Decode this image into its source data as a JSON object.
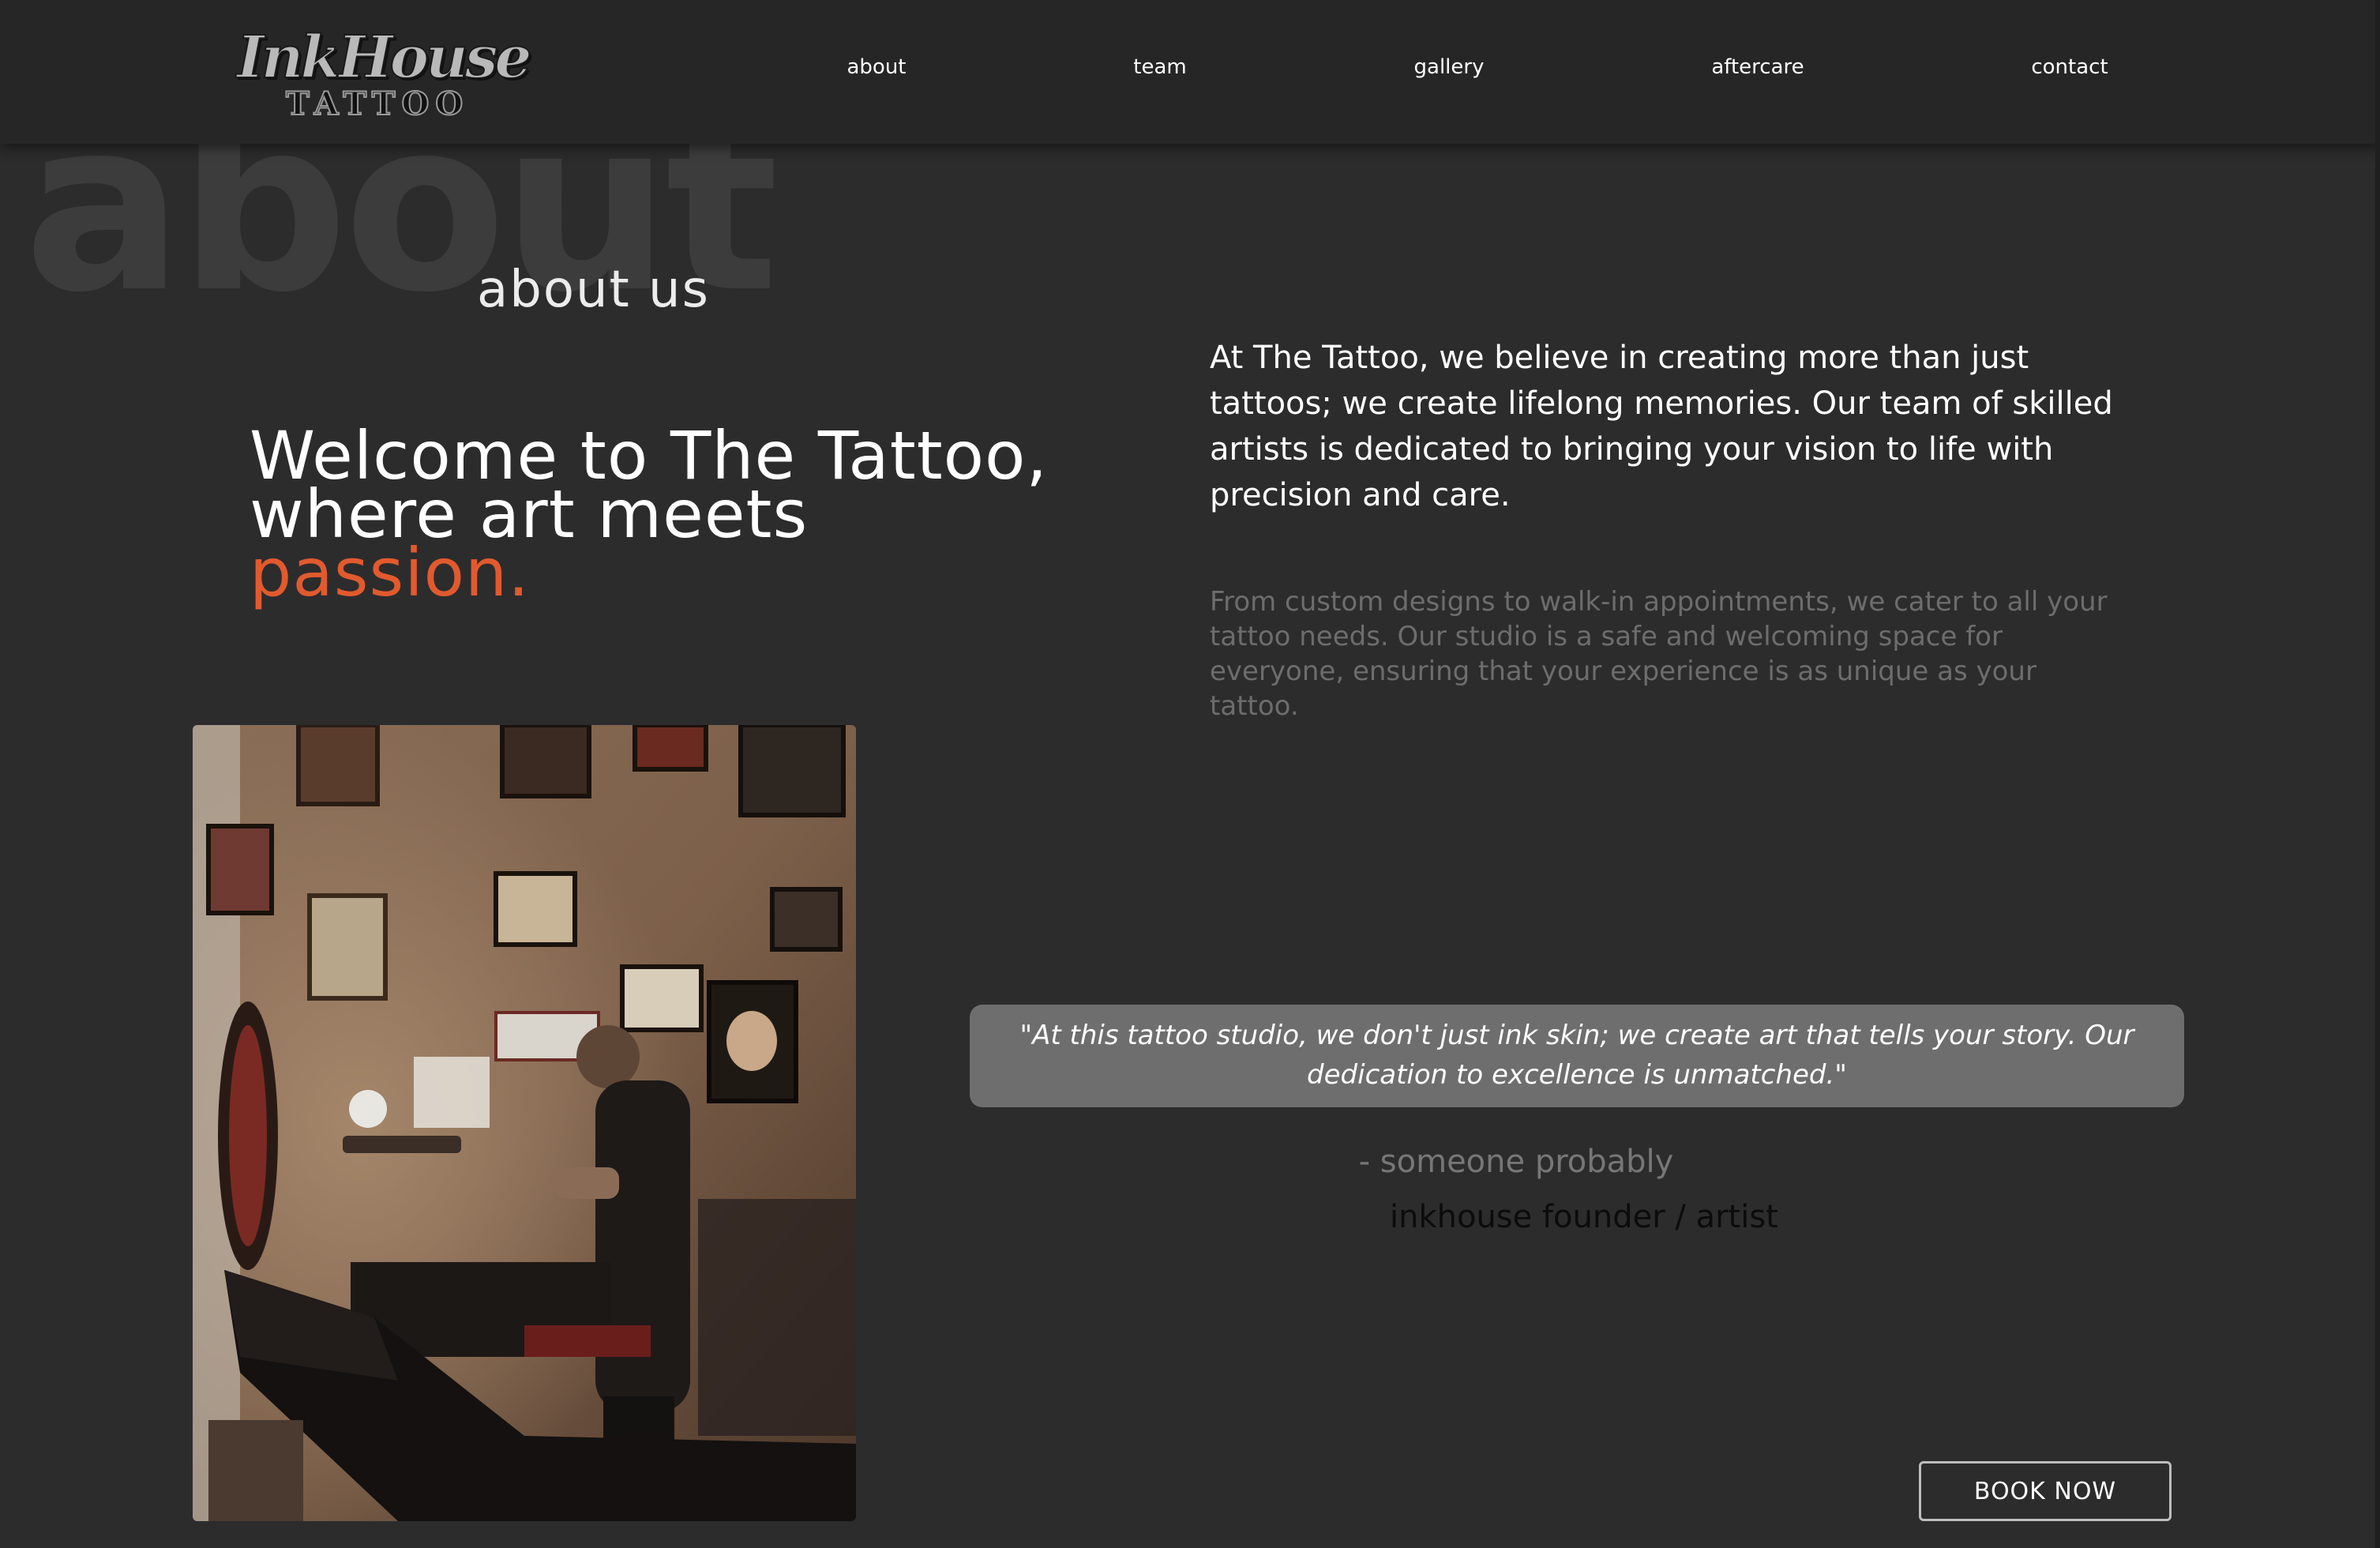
{
  "header": {
    "logo": {
      "script": "InkHouse",
      "sub": "TATTOO"
    },
    "nav": [
      {
        "label": "about"
      },
      {
        "label": "team"
      },
      {
        "label": "gallery"
      },
      {
        "label": "aftercare"
      },
      {
        "label": "contact"
      }
    ]
  },
  "hero": {
    "ghost_word": "about",
    "section_title": "about us",
    "welcome_line1": "Welcome to The Tattoo,",
    "welcome_line2": "where art meets",
    "welcome_accent": "passion.",
    "intro": "At The Tattoo, we believe in creating more than just tattoos; we create lifelong memories. Our team of skilled artists is dedicated to bringing your vision to life with precision and care.",
    "intro_secondary": "From custom designs to walk-in appointments, we cater to all your tattoo needs. Our studio is a safe and welcoming space for everyone, ensuring that your experience is as unique as your tattoo."
  },
  "testimonial": {
    "quote": "\"At this tattoo studio, we don't just ink skin; we create art that tells your story. Our dedication to excellence is unmatched.\"",
    "author": "- someone probably",
    "role": "inkhouse founder / artist"
  },
  "cta": {
    "book_label": "BOOK NOW"
  },
  "colors": {
    "background": "#2c2c2d",
    "header": "#262627",
    "accent": "#e15a2e",
    "quote_box": "#6e6e6f"
  }
}
